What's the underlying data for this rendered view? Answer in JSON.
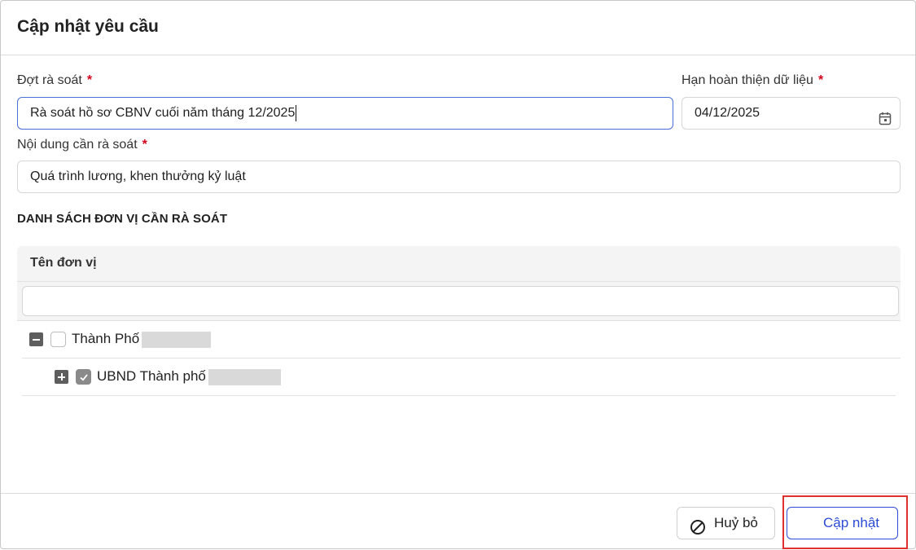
{
  "dialog": {
    "title": "Cập nhật yêu cầu"
  },
  "form": {
    "review_round": {
      "label": "Đợt rà soát",
      "required_mark": "*",
      "value": "Rà soát hồ sơ CBNV cuối năm tháng 12/2025"
    },
    "deadline": {
      "label": "Hạn hoàn thiện dữ liệu",
      "required_mark": "*",
      "value": "04/12/2025",
      "icon": "calendar-icon"
    },
    "review_content": {
      "label": "Nội dung cần rà soát",
      "required_mark": "*",
      "value": "Quá trình lương, khen thưởng kỷ luật"
    }
  },
  "units_section": {
    "title": "DANH SÁCH ĐƠN VỊ CẦN RÀ SOÁT",
    "column_header": "Tên đơn vị",
    "filter_value": "",
    "rows": [
      {
        "label": "Thành Phố",
        "expander": "collapse",
        "checked": false,
        "level": 0
      },
      {
        "label": "UBND Thành phố",
        "expander": "expand",
        "checked": true,
        "level": 1
      }
    ]
  },
  "footer": {
    "cancel_label": "Huỷ bỏ",
    "cancel_icon": "ban-icon",
    "update_label": "Cập nhật"
  },
  "colors": {
    "required": "#d0021b",
    "primary": "#2c4bd6",
    "highlight": "#e03131",
    "focus_border": "#4a6fd8"
  }
}
